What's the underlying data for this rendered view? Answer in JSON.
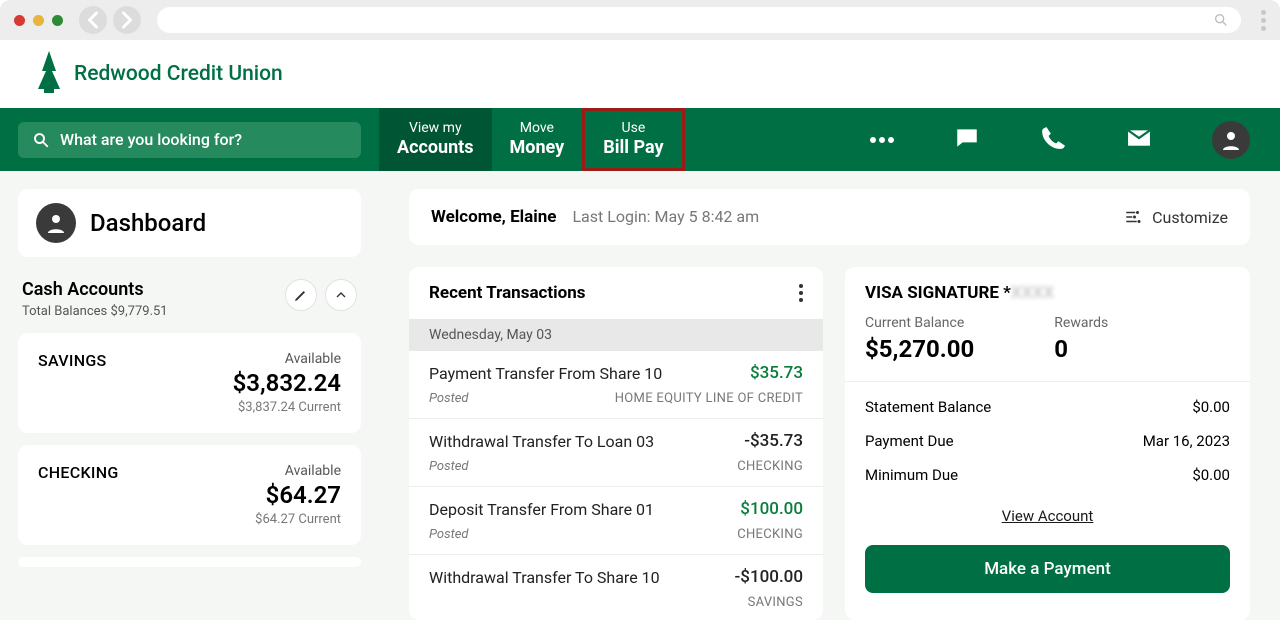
{
  "brand": "Redwood Credit Union",
  "search": {
    "placeholder": "What are you looking for?"
  },
  "nav": {
    "accounts": {
      "small": "View my",
      "big": "Accounts"
    },
    "money": {
      "small": "Move",
      "big": "Money"
    },
    "billpay": {
      "small": "Use",
      "big": "Bill Pay"
    }
  },
  "welcome": {
    "greeting": "Welcome, Elaine",
    "last_login": "Last Login: May 5 8:42 am",
    "customize": "Customize"
  },
  "sidebar": {
    "dashboard": "Dashboard",
    "cash_accounts": "Cash Accounts",
    "total_label": "Total Balances",
    "total_value": "$9,779.51",
    "accounts": [
      {
        "name": "SAVINGS",
        "available_label": "Available",
        "amount": "$3,832.24",
        "current": "$3,837.24 Current"
      },
      {
        "name": "CHECKING",
        "available_label": "Available",
        "amount": "$64.27",
        "current": "$64.27 Current"
      }
    ]
  },
  "transactions": {
    "title": "Recent Transactions",
    "date": "Wednesday, May 03",
    "items": [
      {
        "desc": "Payment Transfer From Share 10",
        "amount": "$35.73",
        "sign": "pos",
        "status": "Posted",
        "source": "HOME EQUITY LINE OF CREDIT"
      },
      {
        "desc": "Withdrawal Transfer To Loan 03",
        "amount": "-$35.73",
        "sign": "neg",
        "status": "Posted",
        "source": "CHECKING"
      },
      {
        "desc": "Deposit Transfer From Share 01",
        "amount": "$100.00",
        "sign": "pos",
        "status": "Posted",
        "source": "CHECKING"
      },
      {
        "desc": "Withdrawal Transfer To Share 10",
        "amount": "-$100.00",
        "sign": "neg",
        "status": "",
        "source": "SAVINGS"
      }
    ]
  },
  "visa": {
    "title_prefix": "VISA SIGNATURE *",
    "masked": "XXXX",
    "current_balance_label": "Current Balance",
    "current_balance": "$5,270.00",
    "rewards_label": "Rewards",
    "rewards": "0",
    "rows": [
      {
        "label": "Statement Balance",
        "value": "$0.00"
      },
      {
        "label": "Payment Due",
        "value": "Mar 16, 2023"
      },
      {
        "label": "Minimum Due",
        "value": "$0.00"
      }
    ],
    "view_account": "View Account",
    "make_payment": "Make a Payment"
  }
}
